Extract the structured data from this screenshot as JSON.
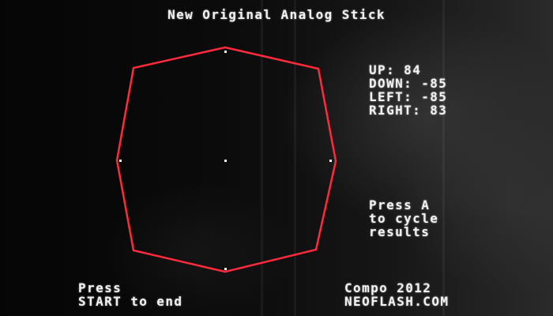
{
  "title": "New Original Analog Stick",
  "readout": {
    "up_label": "UP:",
    "up_value": "84",
    "down_label": "DOWN:",
    "down_value": "-85",
    "left_label": "LEFT:",
    "left_value": "-85",
    "right_label": "RIGHT:",
    "right_value": "83"
  },
  "hint": {
    "line1": "Press A",
    "line2": "to cycle",
    "line3": "results"
  },
  "footer_left": {
    "line1": "Press",
    "line2": "START to end"
  },
  "footer_right": {
    "line1": "Compo 2012",
    "line2": "NEOFLASH.COM"
  },
  "colors": {
    "outline": "#ff2a3c",
    "text": "#f2f2f2",
    "background": "#000000"
  }
}
